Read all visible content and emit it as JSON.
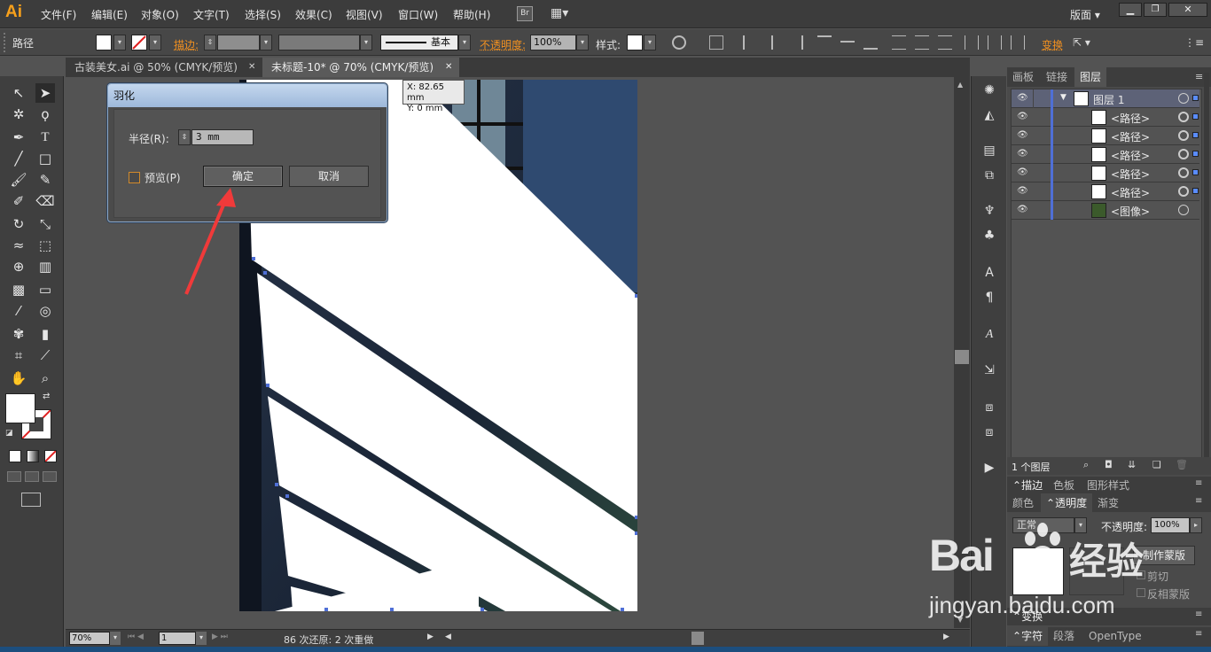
{
  "app": {
    "logo": "Ai"
  },
  "menu": [
    "文件(F)",
    "编辑(E)",
    "对象(O)",
    "文字(T)",
    "选择(S)",
    "效果(C)",
    "视图(V)",
    "窗口(W)",
    "帮助(H)"
  ],
  "menu_right": {
    "br": "Br",
    "workspace": "版面"
  },
  "control": {
    "selection_label": "路径",
    "stroke_label": "描边:",
    "stroke_style": "基本",
    "opacity_label": "不透明度:",
    "opacity_value": "100%",
    "style_label": "样式:",
    "transform_label": "变换"
  },
  "tabs": [
    {
      "label": "古装美女.ai @ 50% (CMYK/预览)",
      "close": "✕"
    },
    {
      "label": "未标题-10* @ 70% (CMYK/预览)",
      "close": "✕"
    }
  ],
  "coords": {
    "x": "X: 82.65 mm",
    "y": "Y: 0 mm"
  },
  "dialog": {
    "title": "羽化",
    "radius_label": "半径(R):",
    "radius_value": "3 mm",
    "preview_label": "预览(P)",
    "ok_label": "确定",
    "cancel_label": "取消"
  },
  "panels": {
    "top_tabs": [
      "画板",
      "链接",
      "图层"
    ],
    "layers": [
      {
        "name": "图层 1",
        "type": "layer"
      },
      {
        "name": "<路径>",
        "type": "path"
      },
      {
        "name": "<路径>",
        "type": "path"
      },
      {
        "name": "<路径>",
        "type": "path"
      },
      {
        "name": "<路径>",
        "type": "path"
      },
      {
        "name": "<路径>",
        "type": "path"
      },
      {
        "name": "<图像>",
        "type": "image"
      }
    ],
    "layer_count": "1 个图层",
    "mid_tabs": [
      "描边",
      "色板",
      "图形样式"
    ],
    "trans_tabs": [
      "颜色",
      "透明度",
      "渐变"
    ],
    "blend_mode": "正常",
    "trans_opacity_label": "不透明度:",
    "trans_opacity_value": "100%",
    "make_mask": "制作蒙版",
    "clip": "剪切",
    "invert_mask": "反相蒙版",
    "transform_tab": "变换",
    "bottom_tabs": [
      "字符",
      "段落",
      "OpenType"
    ]
  },
  "status": {
    "zoom": "70%",
    "page": "1",
    "undo_text": "86 次还原: 2 次重做"
  },
  "watermark": {
    "logo": "Bai",
    "paw": "",
    "jingyan": "经验",
    "url": "jingyan.baidu.com"
  },
  "colors": {
    "accent_orange": "#f19020",
    "arrow_red": "#f03a3a",
    "selection_blue": "#4f6fd6"
  }
}
